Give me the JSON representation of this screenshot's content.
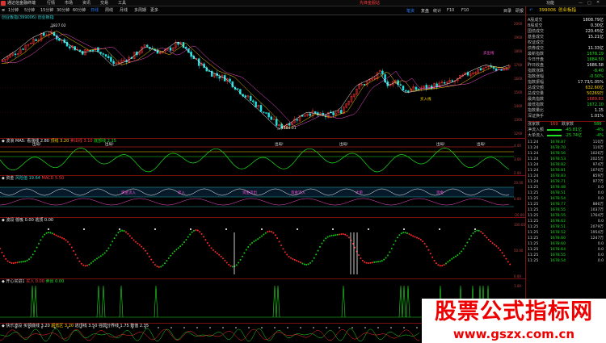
{
  "window": {
    "app_name": "通达信金融终端",
    "menus": [
      "行情",
      "市场",
      "资讯",
      "交易",
      "工具"
    ],
    "notice": "先锋金服站",
    "title_right": "功能",
    "logo": "通达信"
  },
  "toolbar": {
    "periods": [
      "1分钟",
      "5分钟",
      "15分钟",
      "30分钟",
      "60分钟",
      "日线",
      "周线",
      "月线",
      "多周期",
      "更多"
    ],
    "active_period": "日线",
    "right_tabs": [
      "笔资",
      "复盘",
      "统计",
      "F10",
      "F10",
      "目录",
      "研报"
    ],
    "active_right_tab": "笔资"
  },
  "main": {
    "title": "创业板指(399006) 创业板指",
    "high_label": "1827.02",
    "low_label": "1184.01",
    "annot1": "卖出线",
    "annot2": "买入线",
    "axis": [
      "2000",
      "1900",
      "1800",
      "1700",
      "1600",
      "1500",
      "1400",
      "1300",
      "1200"
    ]
  },
  "panes": [
    {
      "name": "波浪",
      "items": [
        {
          "t": "MA5:",
          "c": "white"
        },
        {
          "t": "看涨线 2.80",
          "c": "white"
        },
        {
          "t": "顶线 3.20",
          "c": "yellow"
        },
        {
          "t": "卖出线 3.10",
          "c": "red"
        },
        {
          "t": "底部线 2.15",
          "c": "green"
        }
      ],
      "axis": [
        "4.00",
        "3.00",
        "2.00"
      ],
      "labels": [
        "出局!",
        "出局!",
        "出局!",
        "出局!",
        "出局!",
        "出局!"
      ]
    },
    {
      "name": "资金",
      "items": [
        {
          "t": "风险值 19.64",
          "c": "cyan"
        },
        {
          "t": "MACD 5.50",
          "c": "red"
        }
      ],
      "axis": [
        "20.00",
        "0.00",
        "-20.00"
      ],
      "labels": [
        "资金流入",
        "流入",
        "资金流出",
        "资金流入",
        "大单",
        "资金"
      ]
    },
    {
      "name": "波段",
      "items": [
        {
          "t": "低吸 0.00",
          "c": "white"
        },
        {
          "t": "逃顶 0.00",
          "c": "white"
        }
      ],
      "axis": [
        "100.00",
        "50.00",
        "0.00"
      ]
    },
    {
      "name": "开心买进1",
      "items": [
        {
          "t": "买入 0.00",
          "c": "red"
        },
        {
          "t": "卖出 0.00",
          "c": "green"
        }
      ],
      "axis": [
        "1.00",
        "0.50"
      ]
    },
    {
      "name": "快乐波段",
      "items": [
        {
          "t": "买领底线 3.20",
          "c": "white"
        },
        {
          "t": "超低区 3.20",
          "c": "yellow"
        },
        {
          "t": "逃顶线 3.50",
          "c": "white"
        },
        {
          "t": "强弱分界线 1.75",
          "c": "white"
        },
        {
          "t": "数值 2.35",
          "c": "white"
        }
      ],
      "axis": [
        "4.00",
        "3.00",
        "2.00",
        "1.00"
      ]
    }
  ],
  "side": {
    "code": "399006",
    "name": "创业板指",
    "rows": [
      {
        "l": "A股成交",
        "v": "1808.79亿",
        "c": "white"
      },
      {
        "l": "B股成交",
        "v": "0.30亿",
        "c": "white"
      },
      {
        "l": "国债成交",
        "v": "220.45亿",
        "c": "white"
      },
      {
        "l": "基金成交",
        "v": "15.21亿",
        "c": "white"
      },
      {
        "l": "权证成交",
        "v": "",
        "c": "white"
      },
      {
        "l": "债券成交",
        "v": "11.33亿",
        "c": "white"
      },
      {
        "l": "最新指数",
        "v": "1678.19",
        "c": "green"
      },
      {
        "l": "今日开盘",
        "v": "1684.50",
        "c": "green"
      },
      {
        "l": "昨日收盘",
        "v": "1686.58",
        "c": "white"
      },
      {
        "l": "指数涨跌",
        "v": "-8.40",
        "c": "green"
      },
      {
        "l": "指数涨幅",
        "v": "-0.50%",
        "c": "green"
      },
      {
        "l": "指数振幅",
        "v": "17.73/1.05%",
        "c": "white"
      },
      {
        "l": "总成交额",
        "v": "632.60亿",
        "c": "yellow"
      },
      {
        "l": "总成交量",
        "v": "50269万",
        "c": "yellow"
      },
      {
        "l": "最高指数",
        "v": "1689.83",
        "c": "red"
      },
      {
        "l": "最低指数",
        "v": "1672.10",
        "c": "green"
      },
      {
        "l": "指数量比",
        "v": "1.15",
        "c": "white"
      },
      {
        "l": "深证换手",
        "v": "1.01%",
        "c": "white"
      }
    ],
    "updown": {
      "l": "涨家数",
      "v1": "169",
      "l2": "跌家数",
      "v2": "586"
    },
    "flow": [
      {
        "l": "净流入额",
        "v": "-45.81亿",
        "p": "-4%"
      },
      {
        "l": "大单流入",
        "v": "-25.74亿",
        "p": "-4%"
      }
    ],
    "ticks": [
      [
        "11:24",
        "1678.87",
        "110万"
      ],
      [
        "11:24",
        "1678.70",
        "110万"
      ],
      [
        "11:24",
        "1678.56",
        "1026万"
      ],
      [
        "11:24",
        "1678.53",
        "2025万"
      ],
      [
        "11:24",
        "1678.82",
        "974万"
      ],
      [
        "11:24",
        "1678.81",
        "1070万"
      ],
      [
        "11:24",
        "1678.83",
        "859万"
      ],
      [
        "11:24",
        "1678.71",
        "977万"
      ],
      [
        "11:25",
        "1678.48",
        "0.0"
      ],
      [
        "11:25",
        "1678.51",
        "0.0"
      ],
      [
        "11:25",
        "1678.54",
        "0.0"
      ],
      [
        "11:25",
        "1678.77",
        "886万"
      ],
      [
        "11:25",
        "1678.55",
        "1037万"
      ],
      [
        "11:25",
        "1678.55",
        "1764万"
      ],
      [
        "11:25",
        "1678.62",
        "0.0"
      ],
      [
        "11:25",
        "1678.51",
        "2079万"
      ],
      [
        "11:25",
        "1678.52",
        "1954万"
      ],
      [
        "11:25",
        "1678.60",
        "1247万"
      ],
      [
        "11:25",
        "1678.60",
        "0.0"
      ],
      [
        "11:25",
        "1678.64",
        "0.0"
      ],
      [
        "11:25",
        "1678.55",
        "0.0"
      ],
      [
        "11:25",
        "1678.54",
        "0.0"
      ]
    ]
  },
  "watermark": {
    "line1": "股票公式指标网",
    "line2": "www.gszx.com.cn"
  }
}
